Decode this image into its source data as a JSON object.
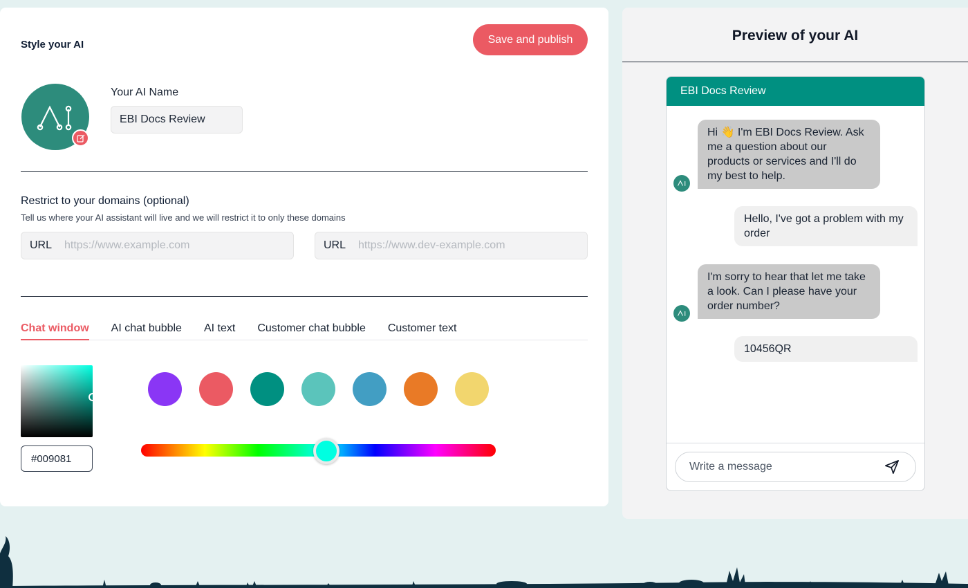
{
  "editor": {
    "title": "Style your AI",
    "save_label": "Save and publish",
    "ai_name_label": "Your AI Name",
    "ai_name_value": "EBI Docs Review",
    "avatar_icon": "ai-logo-icon",
    "avatar_edit_icon": "edit-icon",
    "domains_title": "Restrict to your domains (optional)",
    "domains_subtitle": "Tell us where your AI assistant will live and we will restrict it to only these domains",
    "url_fields": [
      {
        "label": "URL",
        "placeholder": "https://www.example.com",
        "value": ""
      },
      {
        "label": "URL",
        "placeholder": "https://www.dev-example.com",
        "value": ""
      }
    ],
    "tabs": [
      {
        "label": "Chat window",
        "active": true
      },
      {
        "label": "AI chat bubble",
        "active": false
      },
      {
        "label": "AI text",
        "active": false
      },
      {
        "label": "Customer chat bubble",
        "active": false
      },
      {
        "label": "Customer text",
        "active": false
      }
    ],
    "hex_value": "#009081",
    "swatches": [
      "#8a36f5",
      "#eb5a63",
      "#009081",
      "#5bc4bb",
      "#429ec3",
      "#e97a26",
      "#f2d66e"
    ],
    "accent_color": "#eb5a63"
  },
  "preview": {
    "title": "Preview of your AI",
    "chat_header": "EBI Docs Review",
    "header_color": "#009081",
    "messages": [
      {
        "from": "ai",
        "text": "Hi 👋 I'm EBI Docs Review. Ask me a question about our products or services and I'll do my best to help."
      },
      {
        "from": "customer",
        "text": "Hello, I've got a problem with my order"
      },
      {
        "from": "ai",
        "text": "I'm sorry to hear that let me take a look. Can I please have your order number?"
      },
      {
        "from": "customer",
        "text": "10456QR"
      }
    ],
    "input_placeholder": "Write a message",
    "send_icon": "send-icon"
  }
}
